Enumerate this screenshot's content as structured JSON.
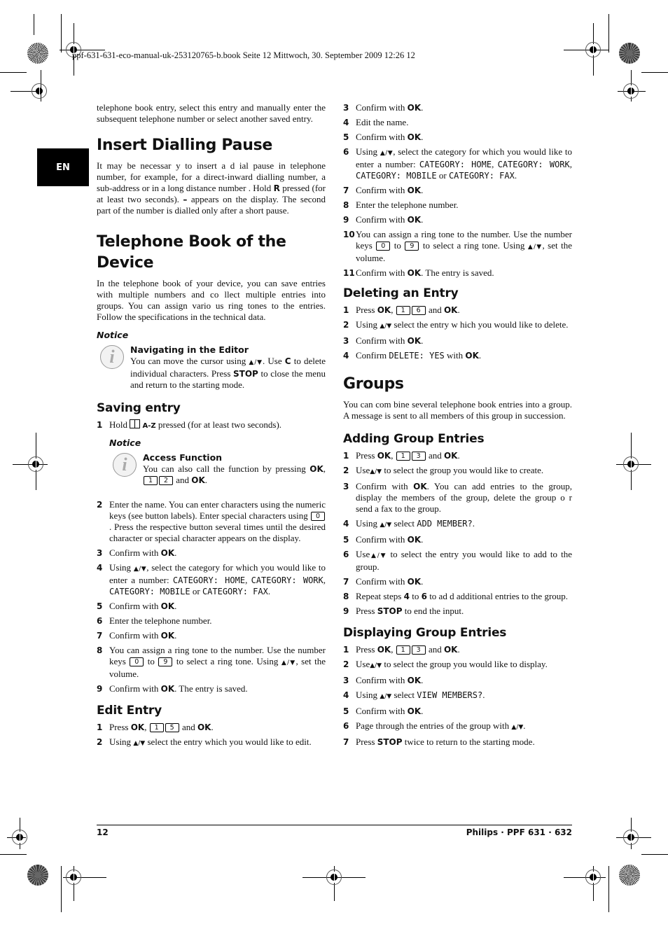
{
  "header": {
    "file_line": "ppf-631-631-eco-manual-uk-253120765-b.book  Seite 12  Mittwoch, 30. September 2009  12:26 12"
  },
  "lang_tab": "EN",
  "left": {
    "intro": "telephone book entry, select this entry and manually enter the subsequent telephone number or select another saved entry.",
    "pause": {
      "title": "Insert Dialling Pause",
      "text_a": "It may be necessar y to insert a d ial pause in telephone number, for example, for a direct-inward dialling number, a sub-address or in a long distance number . Hold ",
      "key_r": "R",
      "text_b": " pressed (for at least two seconds). ",
      "dash": "–",
      "text_c": " appears on the display. The second part of the number is dialled only after a short pause."
    },
    "phonebook": {
      "title": "Telephone Book of the Device",
      "text": "In the telephone book of your device, you can save entries with multiple numbers and co llect multiple entries into groups. You can assign vario us ring tones to the entries. Follow the specifications in the technical data.",
      "notice_label": "Notice",
      "notice_title": "Navigating in the Editor",
      "notice_a": "You can move the cursor using ",
      "notice_b": ". Use ",
      "notice_c_key": "C",
      "notice_d": " to delete individual characters. Press ",
      "notice_stop": "STOP",
      "notice_e": " to close the menu and return to the starting mode."
    },
    "saving": {
      "title": "Saving entry",
      "s1_a": "Hold ",
      "s1_key": "A-Z",
      "s1_b": " pressed (for at least two seconds).",
      "notice_label": "Notice",
      "notice_title": "Access Function",
      "notice_a": "You can also call the function by pressing ",
      "ok": "OK",
      "k1": "1",
      "k2": "2",
      "and": " and ",
      "s2_a": "Enter the name. You can enter characters using the numeric keys (see button labels). Enter special characters using ",
      "s2_key": "0",
      "s2_b": ". Press the respective button several times until the desired character or special character appears on the display.",
      "confirm": "Confirm with ",
      "s4_a": "Using ",
      "s4_b": ", select the category for which you would like to enter a number: ",
      "cat_home": "CATEGORY: HOME",
      "cat_work": "CATEGORY: WORK",
      "cat_mobile": "CATEGORY: MOBILE",
      "cat_fax": "CATEGORY: FAX",
      "or": " or ",
      "s6": "Enter the telephone number.",
      "s8_a": "You can assign a ring tone to the number. Use the number keys ",
      "k0": "0",
      "to": " to ",
      "k9": "9",
      "s8_b": " to select a ring tone. Using ",
      "s8_c": ", set the volume.",
      "saved": ". The entry is saved."
    },
    "edit": {
      "title": "Edit Entry",
      "press": "Press ",
      "k1": "1",
      "k5": "5",
      "s2_a": "Using ",
      "s2_b": " select the entry which you would like to edit."
    }
  },
  "right": {
    "edit_cont": {
      "s4": "Edit the name.",
      "s8": "Enter the telephone number."
    },
    "deleting": {
      "title": "Deleting an Entry",
      "k1": "1",
      "k6": "6",
      "s2_b": " select the entry w hich you would like to delete.",
      "s4_a": "Confirm ",
      "s4_disp": "DELETE: YES",
      "s4_b": " with "
    },
    "groups": {
      "title": "Groups",
      "text": "You can com bine several telephone book entries into a group. A message is sent to all members of this group in succession."
    },
    "adding": {
      "title": "Adding Group Entries",
      "k1": "1",
      "k3": "3",
      "s2_a": "Use",
      "s2_b": " to select the group you would like to create.",
      "s3_b": ". You can add entries to the group, display the members of the group, delete the group o r send a fax to the group.",
      "s4_a": "Using ",
      "s4_b": " select ",
      "s4_disp": "ADD MEMBER?",
      "s6_b": " to select the entry you would like to add to the group.",
      "s8_a": "Repeat steps ",
      "s8_4": "4",
      "s8_to": " to ",
      "s8_6": "6",
      "s8_b": " to ad d additional entries to the group.",
      "s9_a": "Press ",
      "stop": "STOP",
      "s9_b": " to end the input."
    },
    "displaying": {
      "title": "Displaying Group Entries",
      "k1": "1",
      "k3": "3",
      "s2_b": " to select the group you would like to display.",
      "s4_disp": "VIEW MEMBERS?",
      "s6_a": "Page through the entries of the group with ",
      "s7_b": " twice to return to the starting mode."
    }
  },
  "common": {
    "arrows": "▲/▼",
    "ok": "OK",
    "confirm": "Confirm with ",
    "press": "Press ",
    "and": " and ",
    "comma": ", ",
    "period": ".",
    "using": "Using ",
    "use": "Use"
  },
  "footer": {
    "page_number": "12",
    "product": "Philips · PPF 631 · 632"
  }
}
